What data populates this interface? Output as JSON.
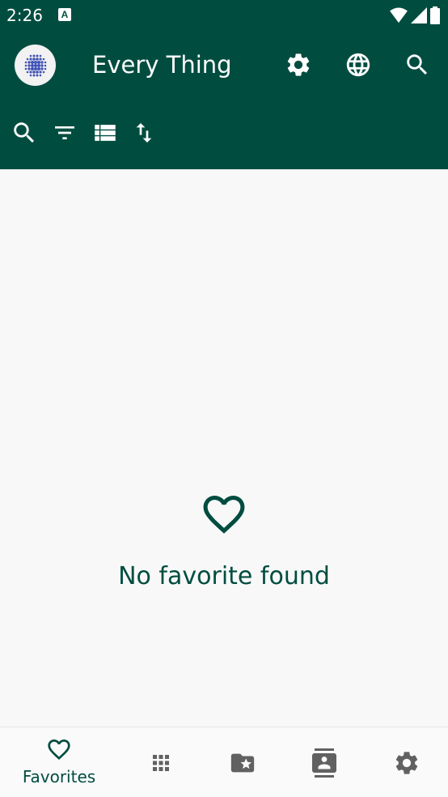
{
  "status_bar": {
    "time": "2:26",
    "notification_letter": "A"
  },
  "app_bar": {
    "title": "Every Thing"
  },
  "empty_state": {
    "message": "No favorite found"
  },
  "bottom_nav": {
    "favorites_label": "Favorites"
  },
  "colors": {
    "primary": "#004d40",
    "background": "#f8f8f8",
    "inactive_icon": "#616161",
    "logo_dots": "#3f51b5"
  }
}
